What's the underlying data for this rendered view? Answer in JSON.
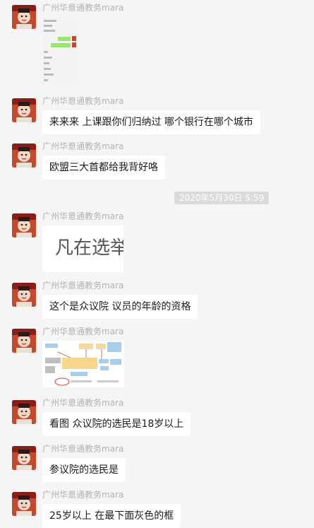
{
  "sender": "广州华意通教务mara",
  "timestamp": "2020年5月30日 5:59",
  "messages": [
    {
      "type": "image",
      "image_desc": "phone-chat-screenshot"
    },
    {
      "type": "text",
      "text": "来来来 上课跟你们归纳过 哪个银行在哪个城市"
    },
    {
      "type": "text",
      "text": "欧盟三大首都给我背好咯"
    },
    {
      "type": "image",
      "image_text": "凡在选举"
    },
    {
      "type": "text",
      "text": "这个是众议院 议员的年龄的资格"
    },
    {
      "type": "image",
      "image_desc": "flowchart-diagram"
    },
    {
      "type": "text",
      "text": "看图 众议院的选民是18岁以上"
    },
    {
      "type": "text",
      "text": "参议院的选民是"
    },
    {
      "type": "text",
      "text": "25岁以上 在最下面灰色的框"
    }
  ]
}
